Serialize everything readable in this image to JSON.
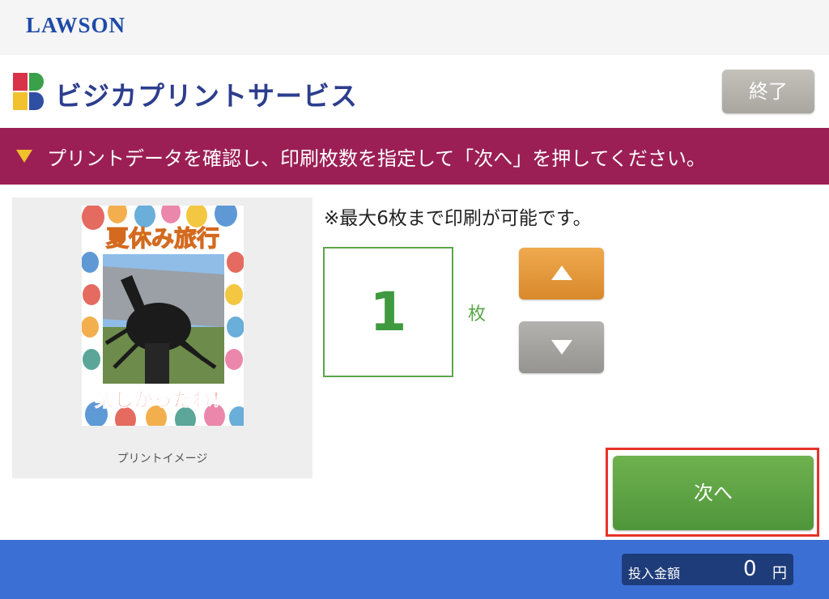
{
  "header": {
    "brand": "LAWSON"
  },
  "service": {
    "title": "ビジカプリントサービス",
    "end_label": "終了"
  },
  "banner": {
    "text": "プリントデータを確認し、印刷枚数を指定して「次へ」を押してください。"
  },
  "preview": {
    "caption": "プリントイメージ",
    "poster_title": "夏休み旅行",
    "poster_footer": "楽しかったね！"
  },
  "quantity": {
    "note": "※最大6枚まで印刷が可能です。",
    "value": "1",
    "unit": "枚"
  },
  "next": {
    "label": "次へ"
  },
  "footer": {
    "money_label": "投入金額",
    "money_value": "0",
    "money_unit": "円"
  },
  "colors": {
    "banner": "#9b1f55",
    "accent_green": "#5ca64c",
    "up_orange": "#e39a3b",
    "footer_blue": "#3b6fd4",
    "highlight_red": "#e63329"
  },
  "icons": [
    "lawson-logo",
    "bizica-logo-icon",
    "banner-triangle-icon",
    "arrow-up-icon",
    "arrow-down-icon"
  ]
}
